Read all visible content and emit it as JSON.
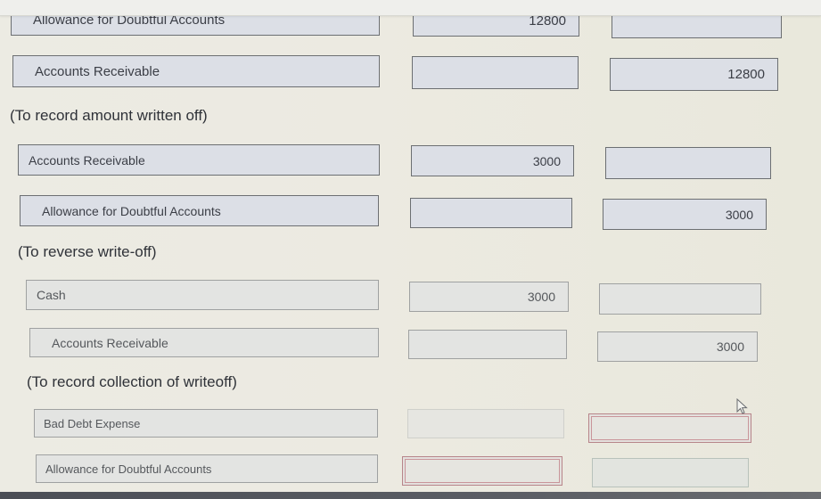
{
  "entries": [
    {
      "lines": [
        {
          "account": "Allowance for Doubtful Accounts",
          "debit": "12800",
          "credit": ""
        },
        {
          "account": "Accounts Receivable",
          "debit": "",
          "credit": "12800"
        }
      ],
      "memo": "(To record amount written off)"
    },
    {
      "lines": [
        {
          "account": "Accounts Receivable",
          "debit": "3000",
          "credit": ""
        },
        {
          "account": "Allowance for Doubtful Accounts",
          "debit": "",
          "credit": "3000"
        }
      ],
      "memo": "(To reverse write-off)"
    },
    {
      "lines": [
        {
          "account": "Cash",
          "debit": "3000",
          "credit": ""
        },
        {
          "account": "Accounts Receivable",
          "debit": "",
          "credit": "3000"
        }
      ],
      "memo": "(To record collection of writeoff)"
    },
    {
      "lines": [
        {
          "account": "Bad Debt Expense",
          "debit": "",
          "credit": ""
        },
        {
          "account": "Allowance for Doubtful Accounts",
          "debit": "",
          "credit": ""
        }
      ]
    }
  ],
  "colors": {
    "field_bg": "#dcdfe6",
    "field_border": "#6c6f72",
    "error_border": "#c9959a"
  }
}
